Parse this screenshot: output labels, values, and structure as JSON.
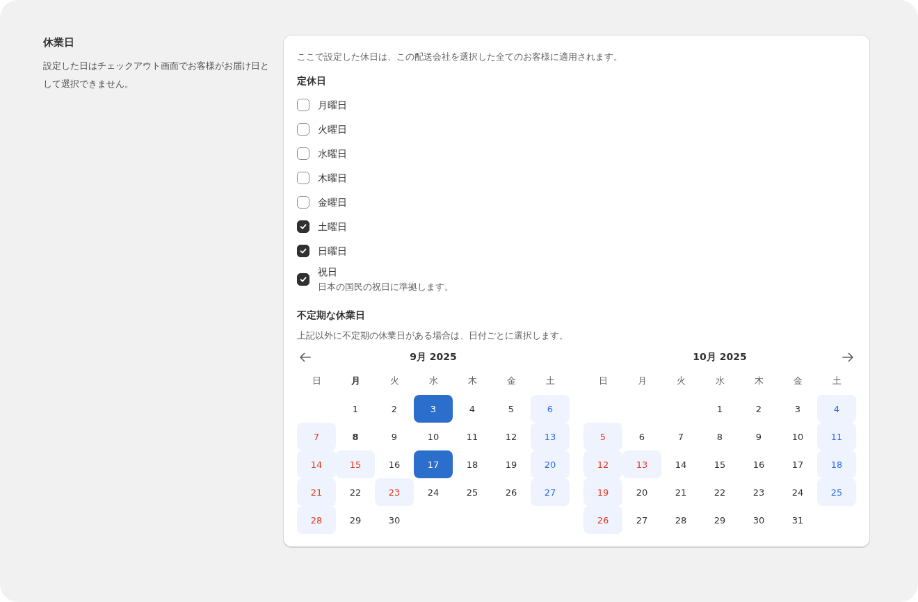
{
  "section": {
    "title": "休業日",
    "description": "設定した日はチェックアウト画面でお客様がお届け日として選択できません。"
  },
  "card": {
    "intro": "ここで設定した休日は、この配送会社を選択した全てのお客様に適用されます。",
    "regular": {
      "heading": "定休日",
      "options": [
        {
          "label": "月曜日",
          "checked": false
        },
        {
          "label": "火曜日",
          "checked": false
        },
        {
          "label": "水曜日",
          "checked": false
        },
        {
          "label": "木曜日",
          "checked": false
        },
        {
          "label": "金曜日",
          "checked": false
        },
        {
          "label": "土曜日",
          "checked": true
        },
        {
          "label": "日曜日",
          "checked": true
        },
        {
          "label": "祝日",
          "checked": true,
          "help": "日本の国民の祝日に準拠します。"
        }
      ]
    },
    "irregular": {
      "heading": "不定期な休業日",
      "description": "上記以外に不定期の休業日がある場合は、日付ごとに選択します。",
      "months": [
        {
          "title": "9月 2025",
          "weekdays": [
            {
              "label": "日",
              "today": false
            },
            {
              "label": "月",
              "today": true
            },
            {
              "label": "火",
              "today": false
            },
            {
              "label": "水",
              "today": false
            },
            {
              "label": "木",
              "today": false
            },
            {
              "label": "金",
              "today": false
            },
            {
              "label": "土",
              "today": false
            }
          ],
          "days": [
            {
              "kind": "blank"
            },
            {
              "d": "1",
              "kind": "normal",
              "closed": false,
              "selected": false
            },
            {
              "d": "2",
              "kind": "normal",
              "closed": false,
              "selected": false
            },
            {
              "d": "3",
              "kind": "normal",
              "closed": false,
              "selected": true
            },
            {
              "d": "4",
              "kind": "normal",
              "closed": false,
              "selected": false
            },
            {
              "d": "5",
              "kind": "normal",
              "closed": false,
              "selected": false
            },
            {
              "d": "6",
              "kind": "saturday",
              "closed": true,
              "selected": false
            },
            {
              "d": "7",
              "kind": "holiday",
              "closed": true,
              "selected": false
            },
            {
              "d": "8",
              "kind": "normal",
              "closed": false,
              "selected": false,
              "today": true
            },
            {
              "d": "9",
              "kind": "normal",
              "closed": false,
              "selected": false
            },
            {
              "d": "10",
              "kind": "normal",
              "closed": false,
              "selected": false
            },
            {
              "d": "11",
              "kind": "normal",
              "closed": false,
              "selected": false
            },
            {
              "d": "12",
              "kind": "normal",
              "closed": false,
              "selected": false
            },
            {
              "d": "13",
              "kind": "saturday",
              "closed": true,
              "selected": false
            },
            {
              "d": "14",
              "kind": "holiday",
              "closed": true,
              "selected": false
            },
            {
              "d": "15",
              "kind": "holiday",
              "closed": true,
              "selected": false
            },
            {
              "d": "16",
              "kind": "normal",
              "closed": false,
              "selected": false
            },
            {
              "d": "17",
              "kind": "normal",
              "closed": false,
              "selected": true
            },
            {
              "d": "18",
              "kind": "normal",
              "closed": false,
              "selected": false
            },
            {
              "d": "19",
              "kind": "normal",
              "closed": false,
              "selected": false
            },
            {
              "d": "20",
              "kind": "saturday",
              "closed": true,
              "selected": false
            },
            {
              "d": "21",
              "kind": "holiday",
              "closed": true,
              "selected": false
            },
            {
              "d": "22",
              "kind": "normal",
              "closed": false,
              "selected": false
            },
            {
              "d": "23",
              "kind": "holiday",
              "closed": true,
              "selected": false
            },
            {
              "d": "24",
              "kind": "normal",
              "closed": false,
              "selected": false
            },
            {
              "d": "25",
              "kind": "normal",
              "closed": false,
              "selected": false
            },
            {
              "d": "26",
              "kind": "normal",
              "closed": false,
              "selected": false
            },
            {
              "d": "27",
              "kind": "saturday",
              "closed": true,
              "selected": false
            },
            {
              "d": "28",
              "kind": "holiday",
              "closed": true,
              "selected": false
            },
            {
              "d": "29",
              "kind": "normal",
              "closed": false,
              "selected": false
            },
            {
              "d": "30",
              "kind": "normal",
              "closed": false,
              "selected": false
            }
          ]
        },
        {
          "title": "10月 2025",
          "weekdays": [
            {
              "label": "日",
              "today": false
            },
            {
              "label": "月",
              "today": false
            },
            {
              "label": "火",
              "today": false
            },
            {
              "label": "水",
              "today": false
            },
            {
              "label": "木",
              "today": false
            },
            {
              "label": "金",
              "today": false
            },
            {
              "label": "土",
              "today": false
            }
          ],
          "days": [
            {
              "kind": "blank"
            },
            {
              "kind": "blank"
            },
            {
              "kind": "blank"
            },
            {
              "d": "1",
              "kind": "normal",
              "closed": false,
              "selected": false
            },
            {
              "d": "2",
              "kind": "normal",
              "closed": false,
              "selected": false
            },
            {
              "d": "3",
              "kind": "normal",
              "closed": false,
              "selected": false
            },
            {
              "d": "4",
              "kind": "saturday",
              "closed": true,
              "selected": false
            },
            {
              "d": "5",
              "kind": "holiday",
              "closed": true,
              "selected": false
            },
            {
              "d": "6",
              "kind": "normal",
              "closed": false,
              "selected": false
            },
            {
              "d": "7",
              "kind": "normal",
              "closed": false,
              "selected": false
            },
            {
              "d": "8",
              "kind": "normal",
              "closed": false,
              "selected": false
            },
            {
              "d": "9",
              "kind": "normal",
              "closed": false,
              "selected": false
            },
            {
              "d": "10",
              "kind": "normal",
              "closed": false,
              "selected": false
            },
            {
              "d": "11",
              "kind": "saturday",
              "closed": true,
              "selected": false
            },
            {
              "d": "12",
              "kind": "holiday",
              "closed": true,
              "selected": false
            },
            {
              "d": "13",
              "kind": "holiday",
              "closed": true,
              "selected": false
            },
            {
              "d": "14",
              "kind": "normal",
              "closed": false,
              "selected": false
            },
            {
              "d": "15",
              "kind": "normal",
              "closed": false,
              "selected": false
            },
            {
              "d": "16",
              "kind": "normal",
              "closed": false,
              "selected": false
            },
            {
              "d": "17",
              "kind": "normal",
              "closed": false,
              "selected": false
            },
            {
              "d": "18",
              "kind": "saturday",
              "closed": true,
              "selected": false
            },
            {
              "d": "19",
              "kind": "holiday",
              "closed": true,
              "selected": false
            },
            {
              "d": "20",
              "kind": "normal",
              "closed": false,
              "selected": false
            },
            {
              "d": "21",
              "kind": "normal",
              "closed": false,
              "selected": false
            },
            {
              "d": "22",
              "kind": "normal",
              "closed": false,
              "selected": false
            },
            {
              "d": "23",
              "kind": "normal",
              "closed": false,
              "selected": false
            },
            {
              "d": "24",
              "kind": "normal",
              "closed": false,
              "selected": false
            },
            {
              "d": "25",
              "kind": "saturday",
              "closed": true,
              "selected": false
            },
            {
              "d": "26",
              "kind": "holiday",
              "closed": true,
              "selected": false
            },
            {
              "d": "27",
              "kind": "normal",
              "closed": false,
              "selected": false
            },
            {
              "d": "28",
              "kind": "normal",
              "closed": false,
              "selected": false
            },
            {
              "d": "29",
              "kind": "normal",
              "closed": false,
              "selected": false
            },
            {
              "d": "30",
              "kind": "normal",
              "closed": false,
              "selected": false
            },
            {
              "d": "31",
              "kind": "normal",
              "closed": false,
              "selected": false
            }
          ]
        }
      ]
    }
  }
}
